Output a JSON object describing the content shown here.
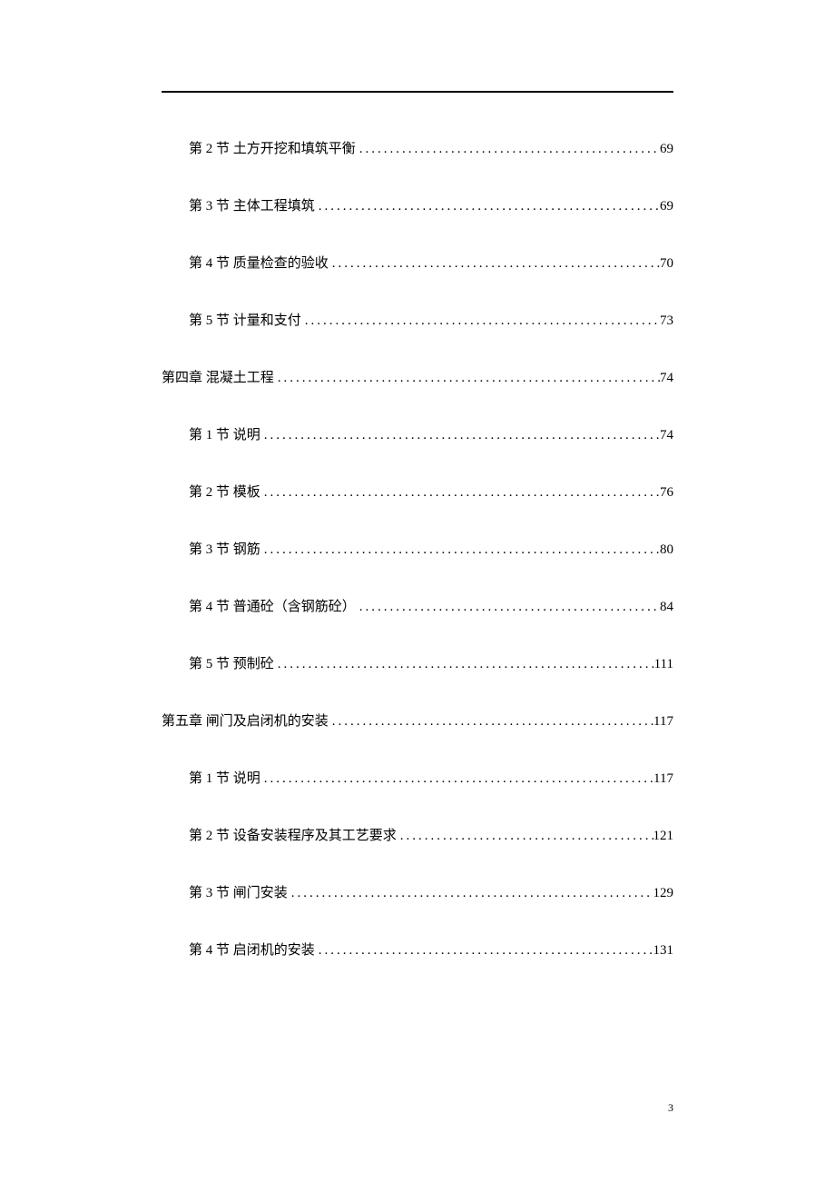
{
  "toc": [
    {
      "level": 2,
      "title": "第 2 节 土方开挖和填筑平衡",
      "page": "69"
    },
    {
      "level": 2,
      "title": "第 3 节 主体工程填筑",
      "page": "69"
    },
    {
      "level": 2,
      "title": "第 4 节 质量检查的验收",
      "page": "70"
    },
    {
      "level": 2,
      "title": "第 5 节 计量和支付",
      "page": "73"
    },
    {
      "level": 1,
      "title": "第四章 混凝土工程",
      "page": "74"
    },
    {
      "level": 2,
      "title": "第 1 节 说明",
      "page": "74"
    },
    {
      "level": 2,
      "title": "第 2 节 模板",
      "page": "76"
    },
    {
      "level": 2,
      "title": "第 3 节 钢筋",
      "page": "80"
    },
    {
      "level": 2,
      "title": "第 4 节 普通砼（含钢筋砼）",
      "page": "84"
    },
    {
      "level": 2,
      "title": "第 5 节 预制砼",
      "page": "111"
    },
    {
      "level": 1,
      "title": "第五章 闸门及启闭机的安装",
      "page": "117"
    },
    {
      "level": 2,
      "title": "第 1 节 说明",
      "page": "117"
    },
    {
      "level": 2,
      "title": "第 2 节 设备安装程序及其工艺要求",
      "page": "121"
    },
    {
      "level": 2,
      "title": "第 3 节 闸门安装",
      "page": "129"
    },
    {
      "level": 2,
      "title": "第 4 节 启闭机的安装",
      "page": "131"
    }
  ],
  "page_number": "3"
}
